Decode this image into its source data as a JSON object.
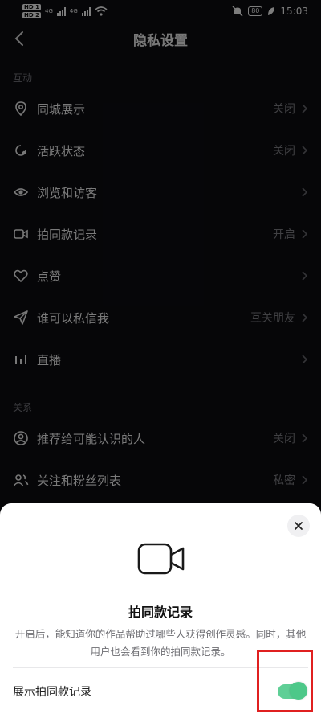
{
  "status_bar": {
    "hd1": "HD 1",
    "hd2": "HD 2",
    "net1": "4G",
    "net2": "4G",
    "battery": "80",
    "time": "15:03"
  },
  "header": {
    "title": "隐私设置",
    "back_icon": "chevron-left-icon"
  },
  "sections": [
    {
      "label": "互动",
      "items": [
        {
          "icon": "location-pin-icon",
          "label": "同城展示",
          "value": "关闭"
        },
        {
          "icon": "activity-status-icon",
          "label": "活跃状态",
          "value": "关闭"
        },
        {
          "icon": "eye-icon",
          "label": "浏览和访客",
          "value": ""
        },
        {
          "icon": "video-camera-icon",
          "label": "拍同款记录",
          "value": "开启"
        },
        {
          "icon": "heart-icon",
          "label": "点赞",
          "value": ""
        },
        {
          "icon": "send-icon",
          "label": "谁可以私信我",
          "value": "互关朋友"
        },
        {
          "icon": "bar-chart-icon",
          "label": "直播",
          "value": ""
        }
      ]
    },
    {
      "label": "关系",
      "items": [
        {
          "icon": "user-circle-icon",
          "label": "推荐给可能认识的人",
          "value": "关闭"
        },
        {
          "icon": "users-icon",
          "label": "关注和粉丝列表",
          "value": "私密"
        }
      ]
    }
  ],
  "sheet": {
    "icon": "video-camera-icon",
    "title": "拍同款记录",
    "description": "开启后，能知道你的作品帮助过哪些人获得创作灵感。同时，其他用户也会看到你的拍同款记录。",
    "toggle_label": "展示拍同款记录",
    "toggle_on": true,
    "close_icon": "close-icon"
  },
  "colors": {
    "background": "#0b0b0f",
    "toggle_on": "#4dc889",
    "highlight": "#e02020"
  }
}
